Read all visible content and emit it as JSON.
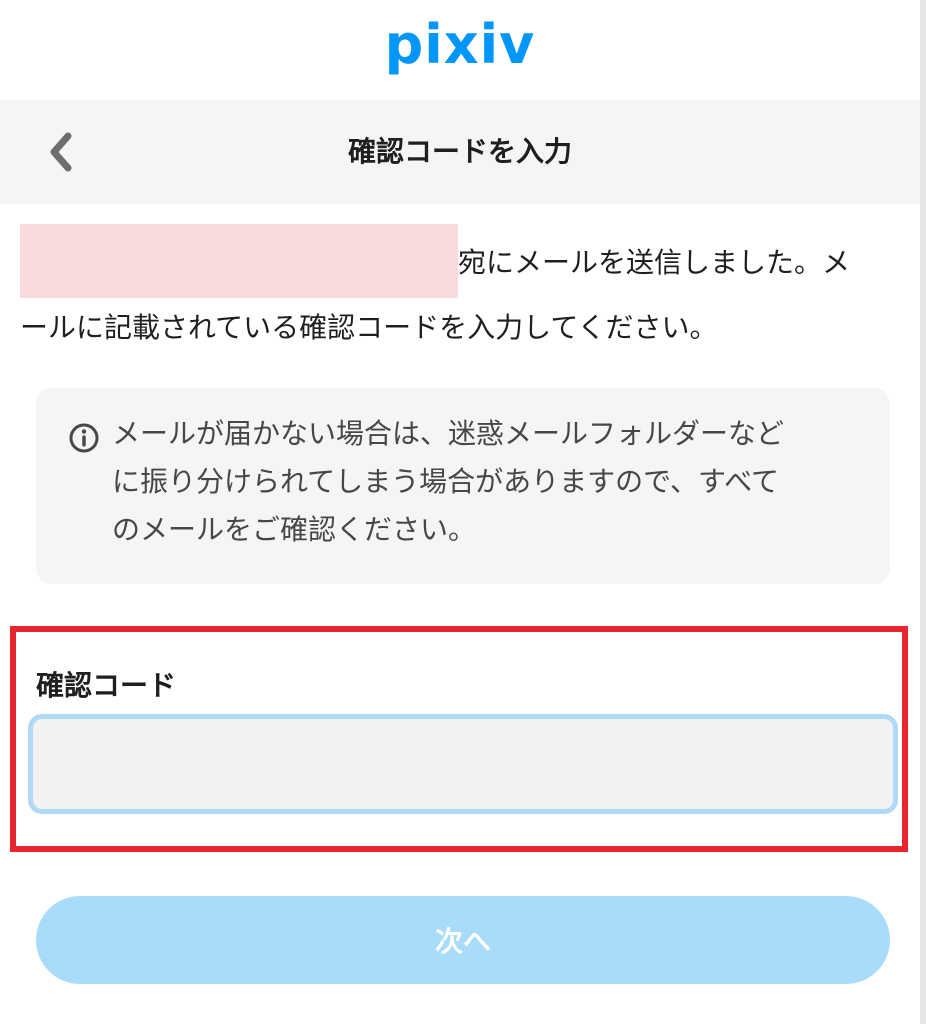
{
  "brand": {
    "logo_text": "pixiv",
    "color": "#0096fa"
  },
  "nav": {
    "back_icon": "chevron-left-icon",
    "title": "確認コードを入力"
  },
  "intro": {
    "line1": "宛にメールを送信しました。メ",
    "line2": "ールに記載されている確認コードを入力してください。"
  },
  "notice": {
    "icon": "info-icon",
    "line1": "メールが届かない場合は、迷惑メールフォルダーなど",
    "line2": "に振り分けられてしまう場合がありますので、すべて",
    "line3": "のメールをご確認ください。"
  },
  "form": {
    "code_label": "確認コード",
    "code_value": "",
    "highlight_color": "#e8262e"
  },
  "actions": {
    "next_label": "次へ"
  }
}
